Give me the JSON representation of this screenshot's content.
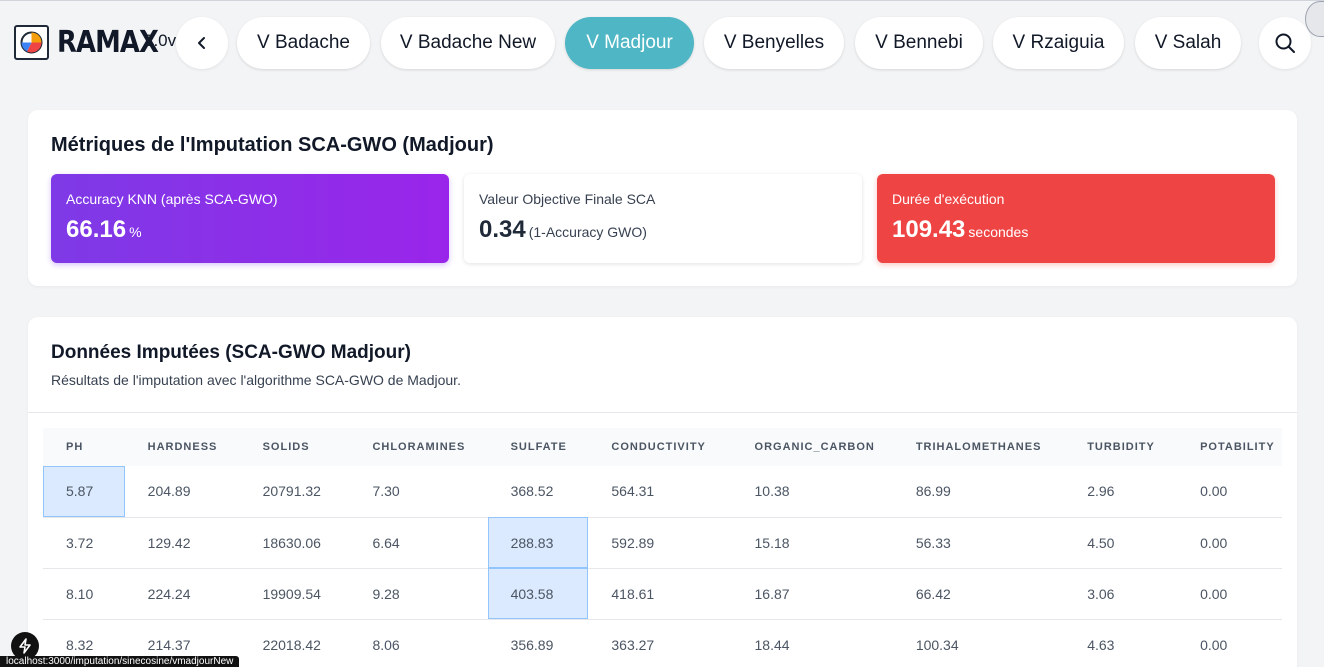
{
  "app": {
    "name": "RAMAX",
    "version": "2.0v"
  },
  "nav": {
    "tabs": [
      {
        "label": "V Badache"
      },
      {
        "label": "V Badache New"
      },
      {
        "label": "V Madjour",
        "active": true
      },
      {
        "label": "V Benyelles"
      },
      {
        "label": "V Bennebi"
      },
      {
        "label": "V Rzaiguia"
      },
      {
        "label": "V Salah"
      }
    ]
  },
  "metrics": {
    "title": "Métriques de l'Imputation SCA-GWO (Madjour)",
    "accuracy": {
      "label": "Accuracy KNN (après SCA-GWO)",
      "value": "66.16",
      "unit": "%"
    },
    "objective": {
      "label": "Valeur Objective Finale SCA",
      "value": "0.34",
      "unit": "(1-Accuracy GWO)"
    },
    "duration": {
      "label": "Durée d'exécution",
      "value": "109.43",
      "unit": "secondes"
    }
  },
  "data_section": {
    "title": "Données Imputées (SCA-GWO Madjour)",
    "subtitle": "Résultats de l'imputation avec l'algorithme SCA-GWO de Madjour.",
    "columns": [
      "PH",
      "HARDNESS",
      "SOLIDS",
      "CHLORAMINES",
      "SULFATE",
      "CONDUCTIVITY",
      "ORGANIC_CARBON",
      "TRIHALOMETHANES",
      "TURBIDITY",
      "POTABILITY"
    ],
    "rows": [
      [
        "5.87",
        "204.89",
        "20791.32",
        "7.30",
        "368.52",
        "564.31",
        "10.38",
        "86.99",
        "2.96",
        "0.00"
      ],
      [
        "3.72",
        "129.42",
        "18630.06",
        "6.64",
        "288.83",
        "592.89",
        "15.18",
        "56.33",
        "4.50",
        "0.00"
      ],
      [
        "8.10",
        "224.24",
        "19909.54",
        "9.28",
        "403.58",
        "418.61",
        "16.87",
        "66.42",
        "3.06",
        "0.00"
      ],
      [
        "8.32",
        "214.37",
        "22018.42",
        "8.06",
        "356.89",
        "363.27",
        "18.44",
        "100.34",
        "4.63",
        "0.00"
      ]
    ],
    "highlighted_cells": [
      [
        0,
        0
      ],
      [
        1,
        4
      ],
      [
        2,
        4
      ]
    ]
  },
  "status_bar": {
    "url": "localhost:3000/imputation/sinecosine/vmadjourNew"
  },
  "colors": {
    "active_tab": "#4eb6c4",
    "accuracy_card": "#8b2fe8",
    "duration_card": "#ef4444",
    "imputed_cell": "#dbeafe"
  }
}
